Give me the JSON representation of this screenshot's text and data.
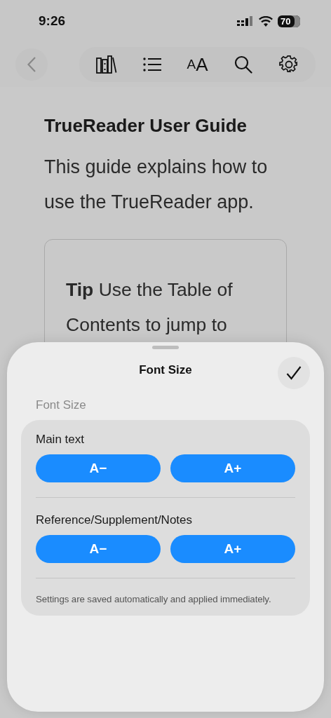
{
  "status_bar": {
    "time": "9:26",
    "battery": "70"
  },
  "toolbar": {
    "buttons": [
      {
        "kind": "library"
      },
      {
        "kind": "contents"
      },
      {
        "kind": "text-size",
        "label": "AA"
      },
      {
        "kind": "search"
      },
      {
        "kind": "settings"
      }
    ]
  },
  "document": {
    "title": "TrueReader User Guide",
    "paragraph": "This guide explains how to use the TrueReader app.",
    "tip": "**Tip** Use the Table of Contents to jump to"
  },
  "sheet": {
    "title": "Font Size",
    "section_label": "Font Size",
    "groups": [
      {
        "label": "Main text",
        "buttons": [
          "A−",
          "A+"
        ]
      },
      {
        "label": "Reference/Supplement/Notes",
        "buttons": [
          "A−",
          "A+"
        ]
      }
    ],
    "footnote": "Settings are saved automatically and applied immediately."
  }
}
